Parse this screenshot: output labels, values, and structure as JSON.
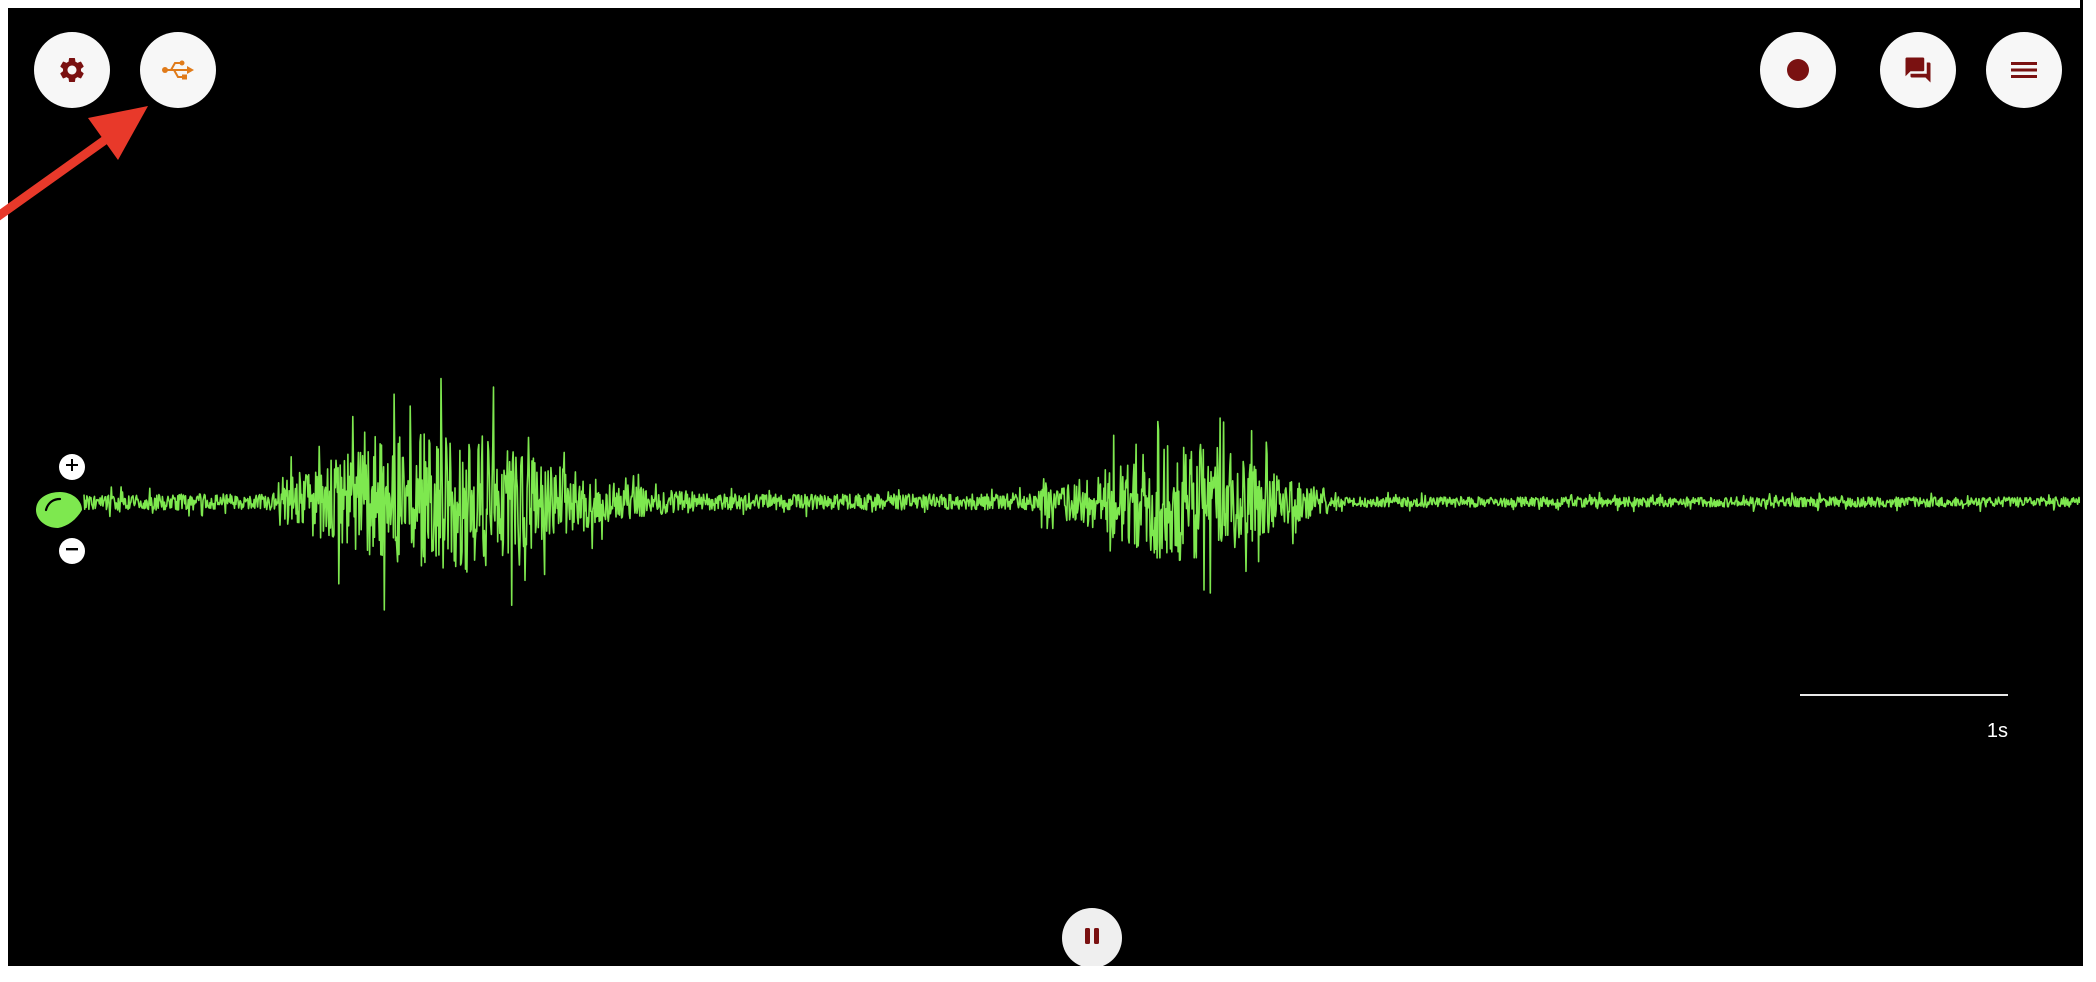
{
  "toolbar": {
    "left_buttons": [
      "settings-button",
      "usb-button"
    ],
    "right_buttons": [
      "record-button",
      "chat-button",
      "menu-button"
    ]
  },
  "icons": {
    "settings": "gear-icon",
    "usb": "usb-icon",
    "record": "record-dot-icon",
    "chat": "chat-bubbles-icon",
    "menu": "hamburger-menu-icon",
    "pause": "pause-icon",
    "zoom_in": "plus-circle-icon",
    "zoom_out": "minus-circle-icon",
    "channel_handle": "channel-drop-handle-icon"
  },
  "colors": {
    "background": "#000000",
    "waveform": "#7ee84f",
    "icon_dark_red": "#7a1111",
    "usb_orange": "#e07b1a",
    "annotation_arrow": "#e8392a",
    "button_face": "#f7f7f7"
  },
  "scale": {
    "label": "1s"
  },
  "playback": {
    "state": "running"
  }
}
